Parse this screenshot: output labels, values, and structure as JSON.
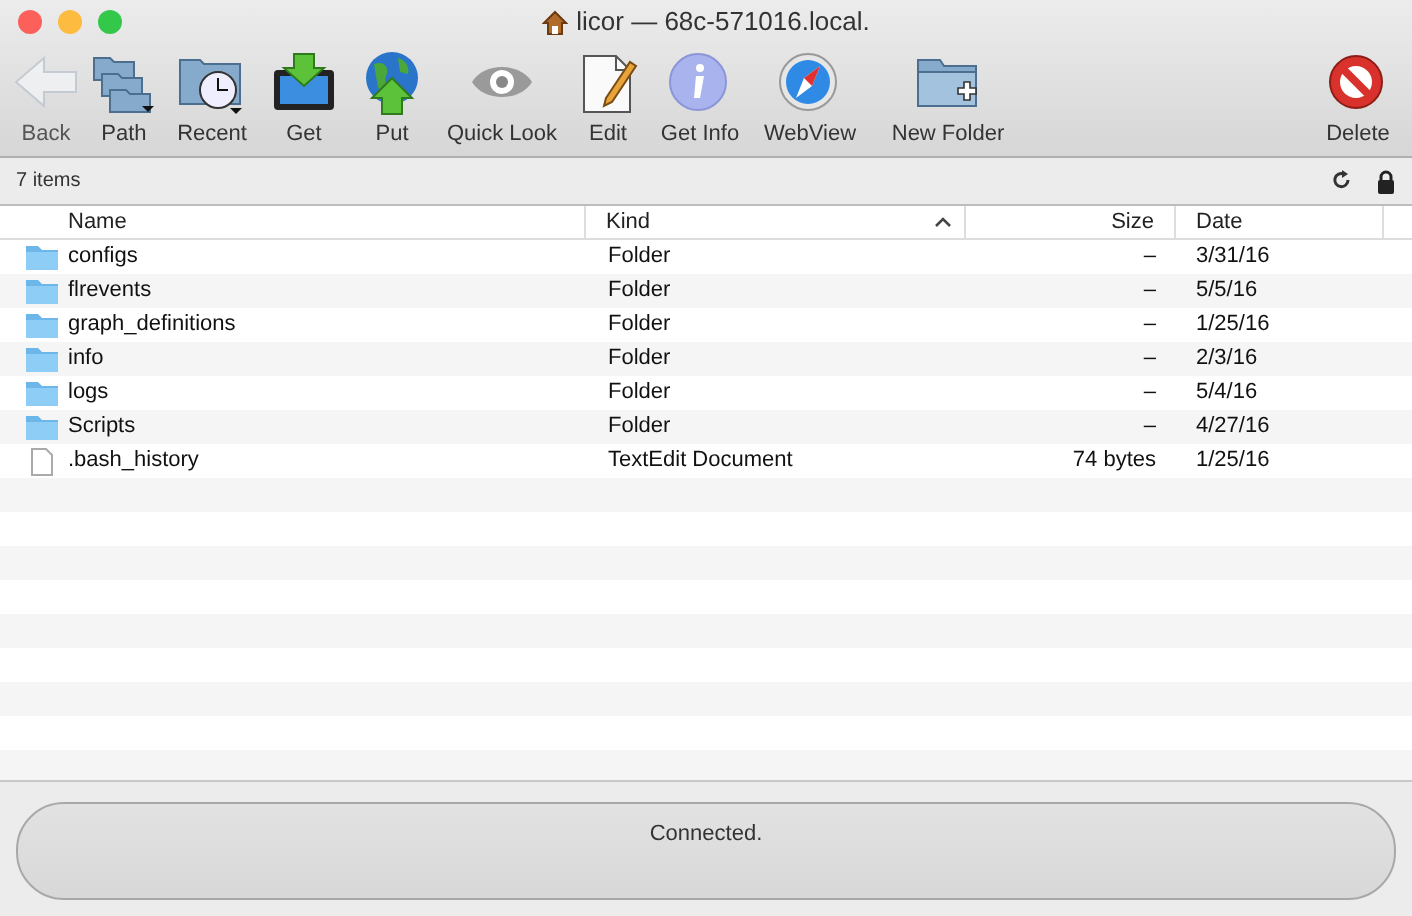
{
  "window": {
    "title": "licor — 68c-571016.local."
  },
  "toolbar": [
    {
      "kind": "back",
      "label": "Back",
      "disabled": true
    },
    {
      "kind": "path",
      "label": "Path",
      "disabled": false
    },
    {
      "kind": "recent",
      "label": "Recent",
      "disabled": false
    },
    {
      "kind": "get",
      "label": "Get",
      "disabled": false
    },
    {
      "kind": "put",
      "label": "Put",
      "disabled": false
    },
    {
      "kind": "quicklook",
      "label": "Quick Look",
      "disabled": false
    },
    {
      "kind": "edit",
      "label": "Edit",
      "disabled": false
    },
    {
      "kind": "info",
      "label": "Get Info",
      "disabled": false
    },
    {
      "kind": "webview",
      "label": "WebView",
      "disabled": false
    },
    {
      "kind": "newfolder",
      "label": "New Folder",
      "disabled": false
    },
    {
      "kind": "delete",
      "label": "Delete",
      "disabled": false
    }
  ],
  "item_count": "7 items",
  "table": {
    "columns": [
      {
        "label": "Name",
        "sorted": false
      },
      {
        "label": "Kind",
        "sorted": true
      },
      {
        "label": "Size",
        "sorted": false
      },
      {
        "label": "Date",
        "sorted": false
      }
    ],
    "rows": [
      {
        "kind": "folder",
        "name": "configs",
        "type": "Folder",
        "size": "–",
        "date": "3/31/16"
      },
      {
        "kind": "folder",
        "name": "flrevents",
        "type": "Folder",
        "size": "–",
        "date": "5/5/16"
      },
      {
        "kind": "folder",
        "name": "graph_definitions",
        "type": "Folder",
        "size": "–",
        "date": "1/25/16"
      },
      {
        "kind": "folder",
        "name": "info",
        "type": "Folder",
        "size": "–",
        "date": "2/3/16"
      },
      {
        "kind": "folder",
        "name": "logs",
        "type": "Folder",
        "size": "–",
        "date": "5/4/16"
      },
      {
        "kind": "folder",
        "name": "Scripts",
        "type": "Folder",
        "size": "–",
        "date": "4/27/16"
      },
      {
        "kind": "file",
        "name": ".bash_history",
        "type": "TextEdit Document",
        "size": "74 bytes",
        "date": "1/25/16"
      }
    ]
  },
  "status": "Connected."
}
